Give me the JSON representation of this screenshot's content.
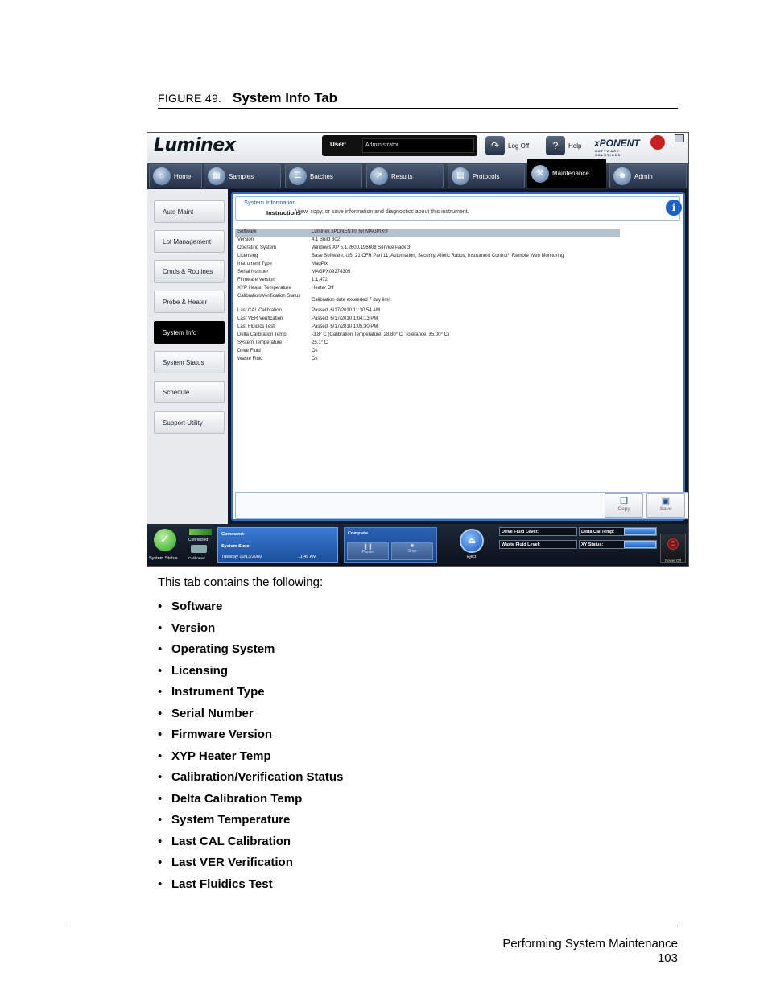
{
  "figure": {
    "number": "FIGURE 49.",
    "title": "System Info Tab"
  },
  "screenshot": {
    "logo": "Luminex",
    "user": {
      "label": "User:",
      "value": "Administrator"
    },
    "top_buttons": {
      "logoff": "Log Off",
      "help": "Help"
    },
    "brand": {
      "name": "xPONENT",
      "sub": "SOFTWARE SOLUTIONS"
    },
    "tabs": [
      {
        "label": "Home",
        "icon": "home-icon"
      },
      {
        "label": "Samples",
        "icon": "samples-icon"
      },
      {
        "label": "Batches",
        "icon": "batches-icon"
      },
      {
        "label": "Results",
        "icon": "results-icon"
      },
      {
        "label": "Protocols",
        "icon": "protocols-icon"
      },
      {
        "label": "Maintenance",
        "icon": "maintenance-icon",
        "active": true
      },
      {
        "label": "Admin",
        "icon": "admin-icon"
      }
    ],
    "sidebar": [
      "Auto Maint",
      "Lot Management",
      "Cmds & Routines",
      "Probe & Heater",
      "System Info",
      "System Status",
      "Schedule",
      "Support Utility"
    ],
    "sidebar_active": "System Info",
    "panel": {
      "title": "System Information",
      "instructions_label": "Instructions",
      "instructions_text": "View, copy, or save information and diagnostics about this instrument."
    },
    "info_rows": [
      {
        "key": "Software",
        "value": "Luminex xPONENT® for MAGPIX®"
      },
      {
        "key": "Version",
        "value": "4.1 Build 302"
      },
      {
        "key": "Operating System",
        "value": "Windows XP 5.1.2600.196608 Service Pack 3"
      },
      {
        "key": "Licensing",
        "value": "Base Software, US, 21 CFR Part 11, Automation, Security, Allelic Ratios, Instrument Control*, Remote Web Monitoring"
      },
      {
        "key": "Instrument Type",
        "value": "MagPix"
      },
      {
        "key": "Serial Number",
        "value": "MAGPX09274309"
      },
      {
        "key": "Firmware Version",
        "value": "1.1.472"
      },
      {
        "key": "XYP Heater Temperature",
        "value": "Heater Off"
      },
      {
        "key": "Calibration/Verification Status",
        "value": "Calibration date exceeded 7 day limit"
      },
      {
        "key": "Last CAL Calibration",
        "value": "Passed: 6/17/2010 11:30:54 AM"
      },
      {
        "key": "Last VER Verification",
        "value": "Passed: 6/17/2010 1:04:13 PM"
      },
      {
        "key": "Last Fluidics Test",
        "value": "Passed: 6/17/2010 1:05:30 PM"
      },
      {
        "key": "Delta Calibration Temp",
        "value": "-3.8° C (Calibration Temperature: 28.80° C, Tolerance: ±5.00° C)"
      },
      {
        "key": "System Temperature",
        "value": "25.1° C"
      },
      {
        "key": "Drive Fluid",
        "value": "Ok"
      },
      {
        "key": "Waste Fluid",
        "value": "Ok"
      }
    ],
    "actions": {
      "copy": "Copy",
      "save": "Save"
    },
    "status": {
      "system_status_label": "System Status",
      "connected": "Connected",
      "calibrated": "Calibrated",
      "command_label": "Command:",
      "system_state_label": "System State:",
      "date": "Tuesday 10/13/2009",
      "time": "11:49 AM",
      "complete_label": "Complete",
      "pause": "Pause",
      "stop": "Stop",
      "eject": "Eject",
      "drive_fluid_level": "Drive Fluid Level:",
      "waste_fluid_level": "Waste Fluid Level:",
      "delta_cal_temp": "Delta Cal Temp:",
      "xy_status": "XY Status:",
      "power_off": "Power Off"
    }
  },
  "body": {
    "intro": "This tab contains the following:",
    "bullets": [
      "Software",
      "Version",
      "Operating System",
      "Licensing",
      "Instrument Type",
      "Serial Number",
      "Firmware Version",
      "XYP Heater Temp",
      "Calibration/Verification Status",
      "Delta Calibration Temp",
      "System Temperature",
      "Last CAL Calibration",
      "Last VER Verification",
      "Last Fluidics Test"
    ]
  },
  "footer": {
    "section": "Performing System Maintenance",
    "page": "103"
  }
}
